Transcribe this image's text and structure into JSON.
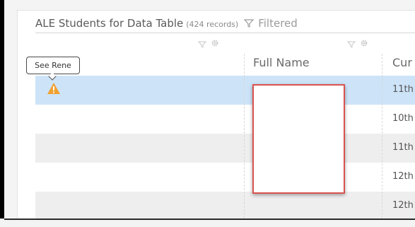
{
  "table": {
    "title": "ALE Students for Data Table",
    "record_count": "(424 records)",
    "filter_status": "Filtered"
  },
  "columns": {
    "full_name": "Full Name",
    "current": "Cur"
  },
  "tooltip": {
    "text": "See Rene"
  },
  "rows": [
    {
      "grade": "11th",
      "state": "selected",
      "has_warning": true
    },
    {
      "grade": "10th",
      "state": "plain"
    },
    {
      "grade": "11th",
      "state": "alt"
    },
    {
      "grade": "12th",
      "state": "plain"
    },
    {
      "grade": "12th",
      "state": "alt"
    }
  ],
  "icons": [
    "filter-icon",
    "gear-icon",
    "warning-icon"
  ],
  "colors": {
    "selected_row": "#cde3f8",
    "alt_row": "#eeeeee",
    "warning": "#f0a030",
    "redaction_border": "#d9534f"
  }
}
